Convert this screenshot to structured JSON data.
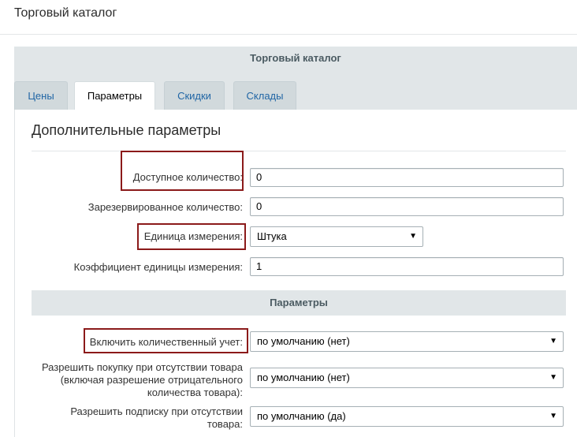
{
  "page": {
    "title": "Торговый каталог"
  },
  "panel": {
    "header": "Торговый каталог"
  },
  "tabs": [
    {
      "label": "Цены"
    },
    {
      "label": "Параметры",
      "active": true
    },
    {
      "label": "Скидки"
    },
    {
      "label": "Склады"
    }
  ],
  "section": {
    "title": "Дополнительные параметры"
  },
  "fields": {
    "available_qty": {
      "label": "Доступное количество:",
      "value": "0"
    },
    "reserved_qty": {
      "label": "Зарезервированное количество:",
      "value": "0"
    },
    "unit": {
      "label": "Единица измерения:",
      "value": "Штука"
    },
    "unit_ratio": {
      "label": "Коэффициент единицы измерения:",
      "value": "1"
    }
  },
  "params": {
    "header": "Параметры",
    "quantity_trace": {
      "label": "Включить количественный учет:",
      "value": "по умолчанию (нет)"
    },
    "allow_purchase": {
      "label_line1": "Разрешить покупку при отсутствии товара",
      "label_line2": "(включая разрешение отрицательного",
      "label_line3": "количества товара):",
      "value": "по умолчанию (нет)"
    },
    "allow_subscribe": {
      "label_line1": "Разрешить подписку при отсутствии",
      "label_line2": "товара:",
      "value": "по умолчанию (да)"
    }
  },
  "icons": {
    "dropdown": "▼"
  },
  "colors": {
    "highlight_box": "#8b1a1a",
    "header_bg": "#e1e6e8",
    "tab_link": "#2166a5"
  }
}
